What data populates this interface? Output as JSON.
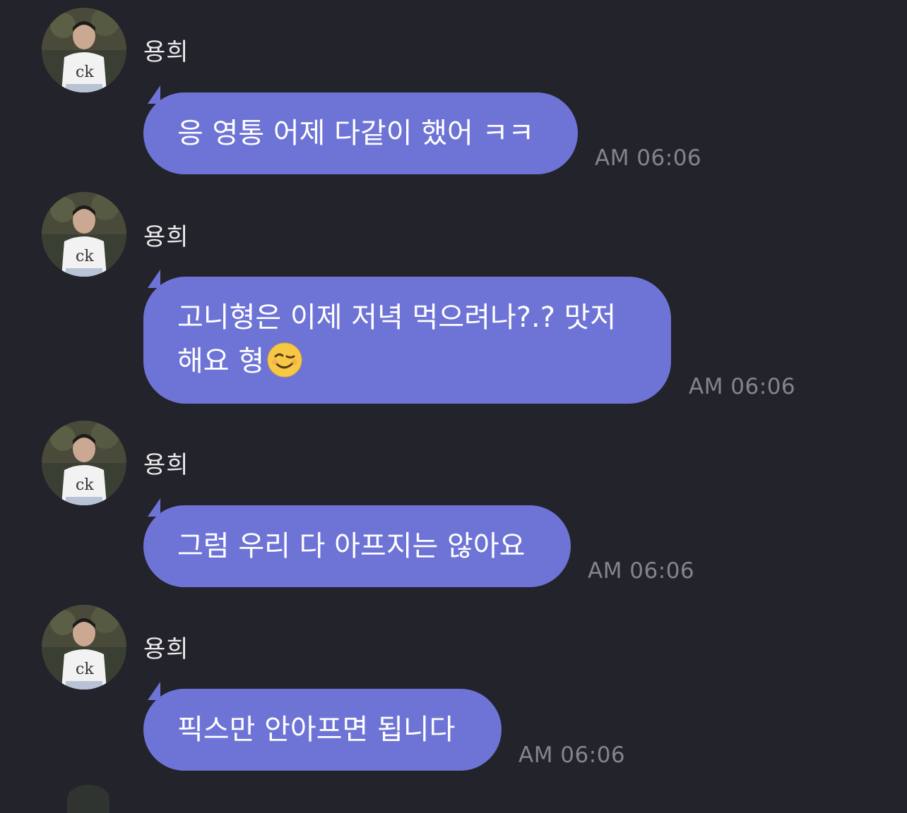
{
  "chat": {
    "messages": [
      {
        "sender": "용희",
        "text": "응 영통 어제 다같이 했어 ㅋㅋ",
        "time": "AM 06:06"
      },
      {
        "sender": "용희",
        "text_line1": "고니형은 이제 저녁 먹으려나?.? 맛저",
        "text_line2": "해요 형",
        "emoji": "winking-face-emoji",
        "time": "AM 06:06"
      },
      {
        "sender": "용희",
        "text": "그럼 우리 다 아프지는 않아요",
        "time": "AM 06:06"
      },
      {
        "sender": "용희",
        "text": "픽스만 안아프면 됩니다",
        "time": "AM 06:06"
      }
    ]
  },
  "colors": {
    "background": "#23232b",
    "bubble": "#6e74d6",
    "time_text": "#84848c",
    "name_text": "#ebebeb"
  }
}
